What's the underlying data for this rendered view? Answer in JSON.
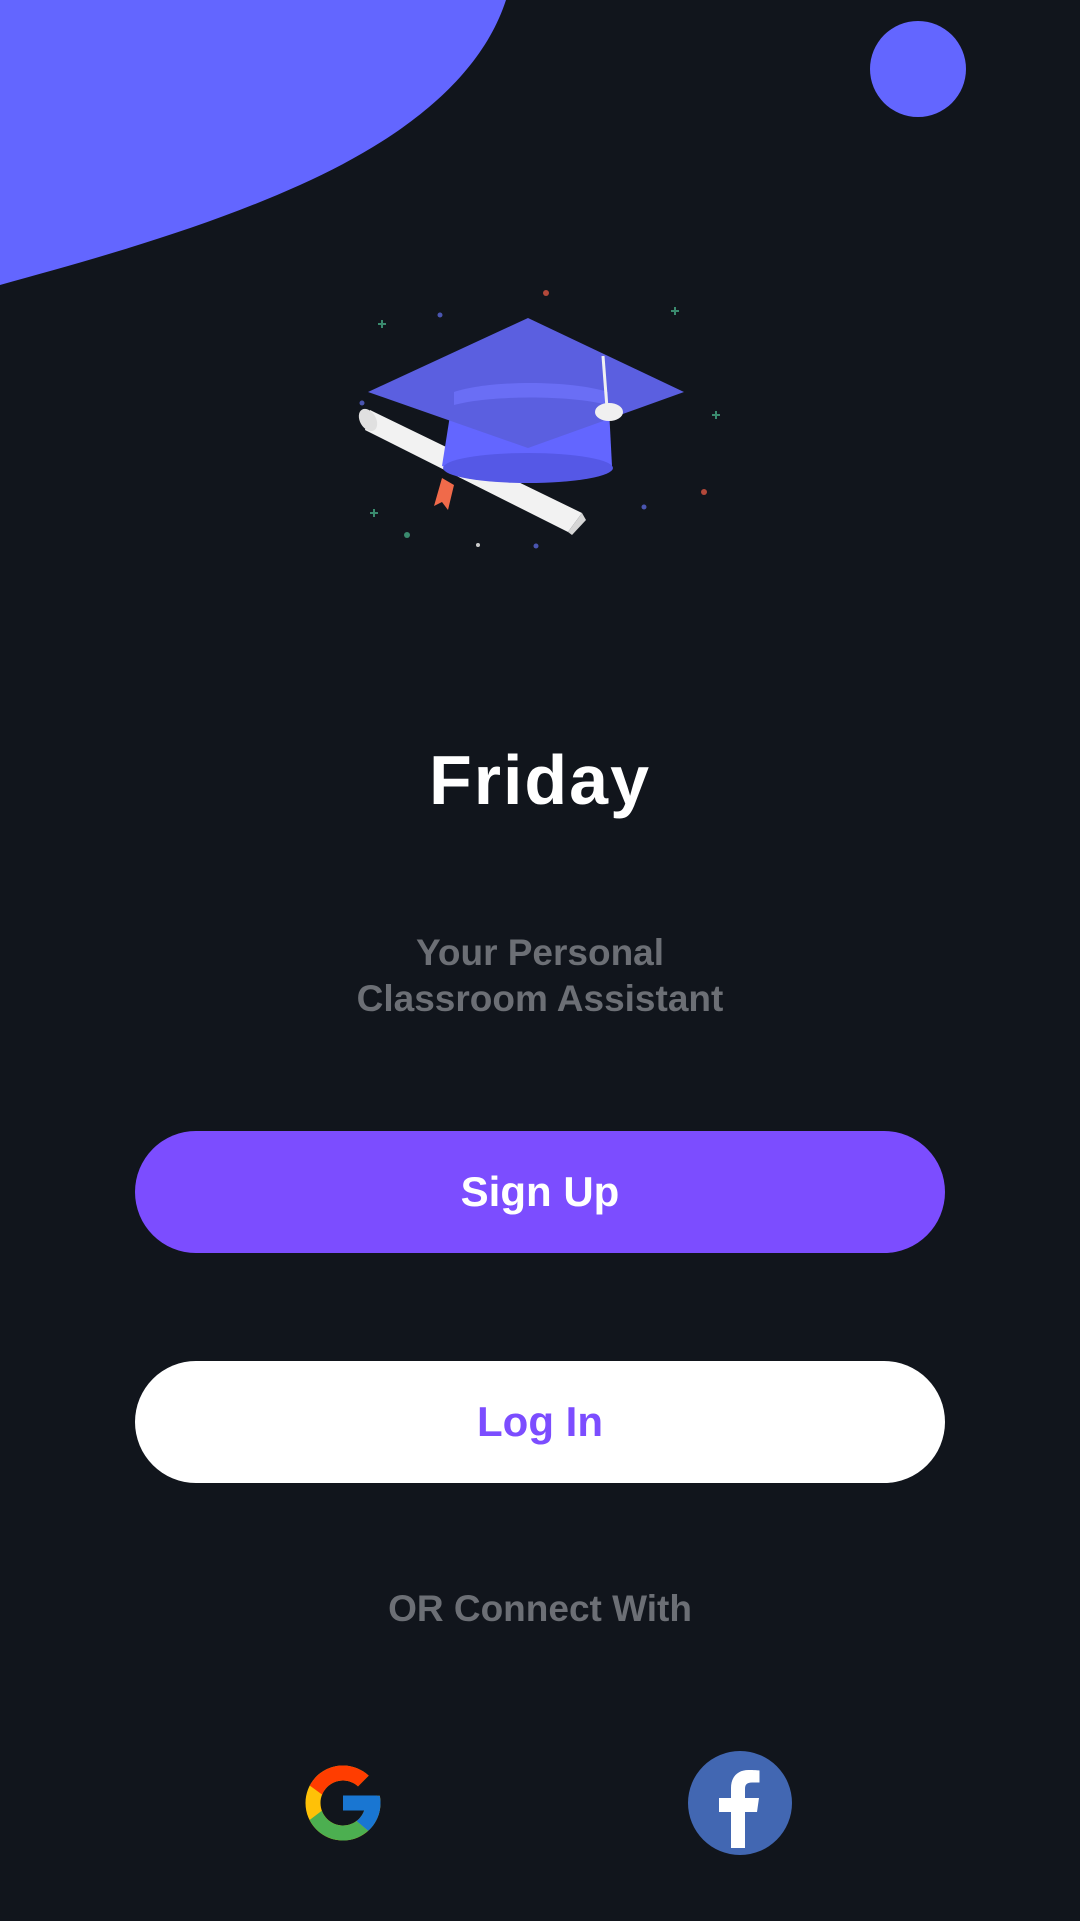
{
  "app": {
    "title": "Friday",
    "tagline_line1": "Your Personal",
    "tagline_line2": "Classroom Assistant"
  },
  "actions": {
    "signup_label": "Sign Up",
    "login_label": "Log In",
    "connect_label": "OR Connect With"
  },
  "social": [
    {
      "name": "google",
      "icon": "google-logo-icon"
    },
    {
      "name": "facebook",
      "icon": "facebook-logo-icon"
    }
  ],
  "illustration": {
    "icon": "graduation-cap-with-diploma-icon"
  },
  "colors": {
    "background": "#11151c",
    "accent": "#6366ff",
    "button_primary": "#7c4dff",
    "button_secondary": "#ffffff",
    "login_text": "#7c4dff",
    "muted_text": "#6c6f75",
    "facebook_blue": "#4267b2"
  }
}
